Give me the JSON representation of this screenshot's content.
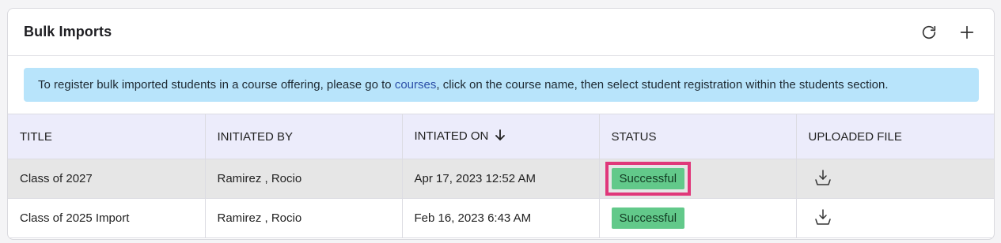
{
  "header": {
    "title": "Bulk Imports",
    "refresh_icon": "refresh-icon",
    "add_icon": "plus-icon"
  },
  "alert": {
    "text_before": "To register bulk imported students in a course offering, please go to ",
    "link": "courses",
    "text_after": ", click on the course name, then select student registration within the students section."
  },
  "table": {
    "columns": [
      "TITLE",
      "INITIATED BY",
      "INTIATED ON",
      "STATUS",
      "UPLOADED FILE"
    ],
    "sort_icon": "arrow-down-icon",
    "rows": [
      {
        "title": "Class of 2027",
        "initiated_by": "Ramirez , Rocio",
        "initiated_on": "Apr 17, 2023 12:52 AM",
        "status": "Successful",
        "file_icon": "download-icon"
      },
      {
        "title": "Class of 2025 Import",
        "initiated_by": "Ramirez , Rocio",
        "initiated_on": "Feb 16, 2023 6:43 AM",
        "status": "Successful",
        "file_icon": "download-icon"
      }
    ]
  },
  "colors": {
    "status_success": "#62c98a",
    "highlight": "#e0387a",
    "alert_bg": "#b8e4fb",
    "header_bg": "#ececfb"
  }
}
